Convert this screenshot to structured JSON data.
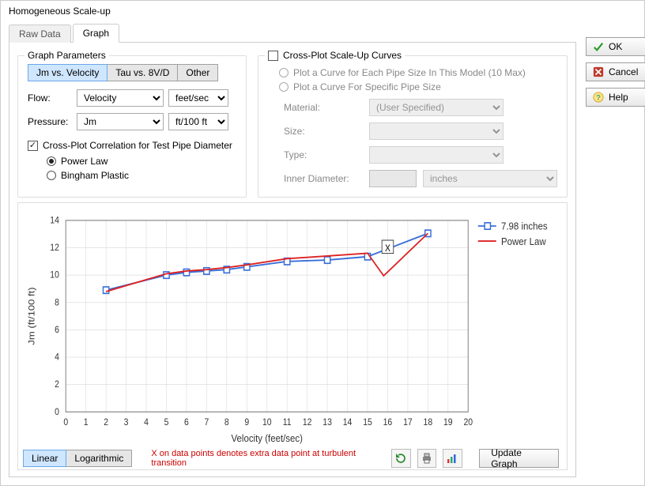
{
  "title": "Homogeneous Scale-up",
  "tabs": {
    "raw": "Raw Data",
    "graph": "Graph"
  },
  "buttons": {
    "ok": "OK",
    "cancel": "Cancel",
    "help": "Help",
    "update": "Update Graph"
  },
  "params": {
    "title": "Graph Parameters",
    "modes": {
      "jm": "Jm vs. Velocity",
      "tau": "Tau vs. 8V/D",
      "other": "Other"
    },
    "flow_label": "Flow:",
    "flow_value": "Velocity",
    "flow_unit": "feet/sec",
    "pressure_label": "Pressure:",
    "pressure_value": "Jm",
    "pressure_unit": "ft/100 ft",
    "crosscorr_label": "Cross-Plot Correlation for Test Pipe Diameter",
    "powerlaw": "Power Law",
    "bingham": "Bingham Plastic"
  },
  "crossplot": {
    "title": "Cross-Plot Scale-Up Curves",
    "opt_each": "Plot a Curve for Each Pipe Size In This Model (10 Max)",
    "opt_specific": "Plot a Curve For Specific Pipe Size",
    "material_label": "Material:",
    "material_value": "(User Specified)",
    "size_label": "Size:",
    "type_label": "Type:",
    "diam_label": "Inner Diameter:",
    "diam_unit": "inches"
  },
  "chart_footer": {
    "linear": "Linear",
    "log": "Logarithmic",
    "note": "X on data points denotes extra data point at turbulent transition"
  },
  "legend": {
    "series1": "7.98 inches",
    "series2": "Power Law"
  },
  "chart_data": {
    "type": "line",
    "xlabel": "Velocity (feet/sec)",
    "ylabel": "Jm (ft/100 ft)",
    "xlim": [
      0,
      20
    ],
    "ylim": [
      0,
      14
    ],
    "xticks": [
      0,
      1,
      2,
      3,
      4,
      5,
      6,
      7,
      8,
      9,
      10,
      11,
      12,
      13,
      14,
      15,
      16,
      17,
      18,
      19,
      20
    ],
    "yticks": [
      0,
      2,
      4,
      6,
      8,
      10,
      12,
      14
    ],
    "extra_marker": {
      "x": 16,
      "y": 12,
      "label": "X"
    },
    "series": [
      {
        "name": "7.98 inches",
        "color": "#3a6fd8",
        "markers": "square",
        "x": [
          2,
          5,
          6,
          7,
          8,
          9,
          11,
          13,
          15,
          18
        ],
        "y": [
          8.9,
          10.0,
          10.2,
          10.3,
          10.4,
          10.6,
          11.0,
          11.1,
          11.35,
          13.05
        ]
      },
      {
        "name": "Power Law",
        "color": "#d22",
        "markers": "none",
        "x": [
          2,
          5,
          6,
          7,
          8,
          9,
          11,
          13,
          15,
          15.8,
          18
        ],
        "y": [
          8.8,
          10.1,
          10.3,
          10.4,
          10.55,
          10.75,
          11.2,
          11.4,
          11.6,
          9.95,
          13.05
        ]
      }
    ]
  }
}
